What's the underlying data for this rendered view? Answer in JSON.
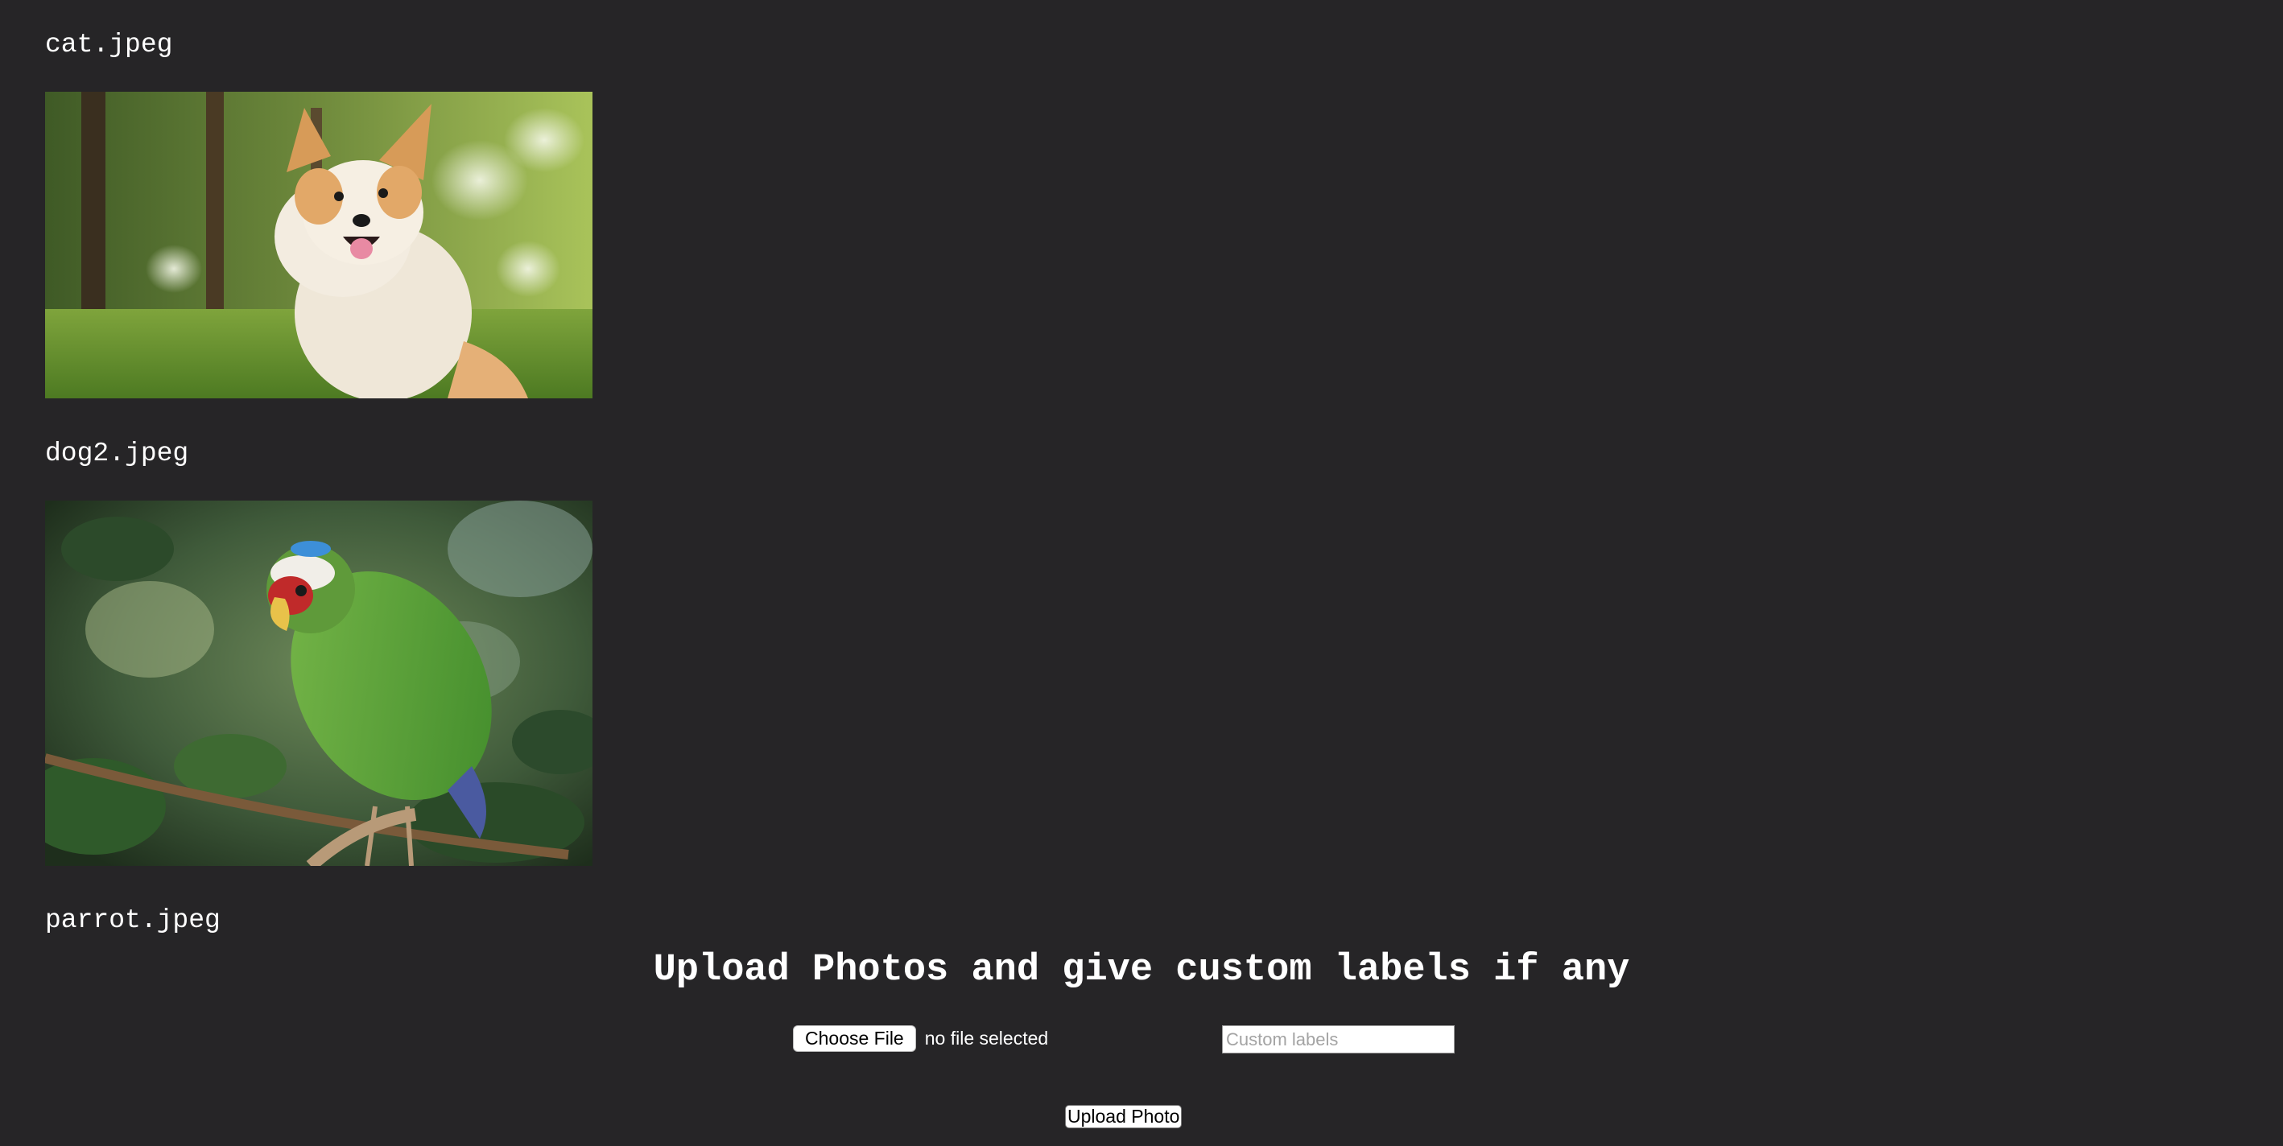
{
  "gallery": {
    "items": [
      {
        "caption": "cat.jpeg",
        "image": "corgi-dog-photo"
      },
      {
        "caption": "dog2.jpeg",
        "image": "green-parrot-photo"
      },
      {
        "caption": "parrot.jpeg",
        "image": ""
      }
    ]
  },
  "upload": {
    "heading": "Upload Photos and give custom labels if any",
    "choose_file_label": "Choose File",
    "no_file_text": "no file selected",
    "labels_placeholder": "Custom labels",
    "upload_button_label": "Upload Photo"
  },
  "colors": {
    "background": "#262527",
    "text": "#ffffff",
    "control_background": "#ffffff"
  }
}
